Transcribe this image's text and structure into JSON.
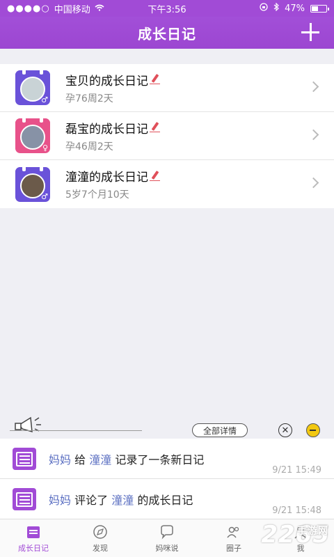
{
  "status_bar": {
    "carrier": "中国移动",
    "time": "下午3:56",
    "battery": "47%",
    "battery_level": 0.47
  },
  "navbar": {
    "title": "成长日记",
    "add_icon": "plus-icon"
  },
  "diaries": [
    {
      "name": "宝贝的成长日记",
      "sub": "孕76周2天",
      "sex": "♂",
      "color": "#6a52d9",
      "photo": "#c9d3d6"
    },
    {
      "name": "磊宝的成长日记",
      "sub": "孕46周2天",
      "sex": "♀",
      "color": "#e8528a",
      "photo": "#8792a6"
    },
    {
      "name": "潼潼的成长日记",
      "sub": "5岁7个月10天",
      "sex": "♂",
      "color": "#6a52d9",
      "photo": "#6b5a4a"
    }
  ],
  "feed_controls": {
    "detail_label": "全部详情",
    "close_icon": "close-circle-icon",
    "minimize_icon": "minus-circle-icon"
  },
  "feed": [
    {
      "actor": "妈妈",
      "verb1": "给",
      "target": "潼潼",
      "verb2": "记录了一条新日记",
      "time": "9/21 15:49"
    },
    {
      "actor": "妈妈",
      "verb1": "评论了",
      "target": "潼潼",
      "verb2": "的成长日记",
      "time": "9/21 15:48"
    }
  ],
  "tabs": [
    {
      "label": "成长日记",
      "icon": "diary-icon",
      "active": true
    },
    {
      "label": "发现",
      "icon": "compass-icon",
      "active": false
    },
    {
      "label": "妈咪说",
      "icon": "chat-bubble-icon",
      "active": false
    },
    {
      "label": "圈子",
      "icon": "people-icon",
      "active": false
    },
    {
      "label": "我",
      "icon": "person-icon",
      "active": false
    }
  ],
  "watermark": {
    "text": "2265",
    "suffix": "手游网"
  },
  "colors": {
    "brand": "#a14bd6",
    "link": "#5b6fc2"
  }
}
